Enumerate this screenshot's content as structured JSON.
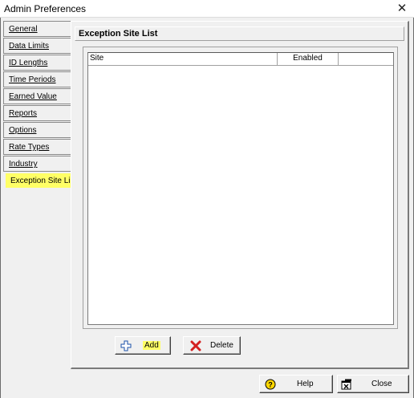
{
  "window": {
    "title": "Admin Preferences"
  },
  "tabs": [
    {
      "label": "General"
    },
    {
      "label": "Data Limits"
    },
    {
      "label": "ID Lengths"
    },
    {
      "label": "Time Periods"
    },
    {
      "label": "Earned Value"
    },
    {
      "label": "Reports"
    },
    {
      "label": "Options"
    },
    {
      "label": "Rate Types"
    },
    {
      "label": "Industry"
    },
    {
      "label": "Exception Site List",
      "active": true
    }
  ],
  "panel": {
    "title": "Exception Site List",
    "columns": [
      "Site",
      "Enabled"
    ],
    "rows": []
  },
  "buttons": {
    "add": "Add",
    "delete": "Delete",
    "help": "Help",
    "close": "Close"
  },
  "colors": {
    "highlight": "#ffff66",
    "delete_icon": "#d42020",
    "add_icon": "#1a4fa8"
  }
}
